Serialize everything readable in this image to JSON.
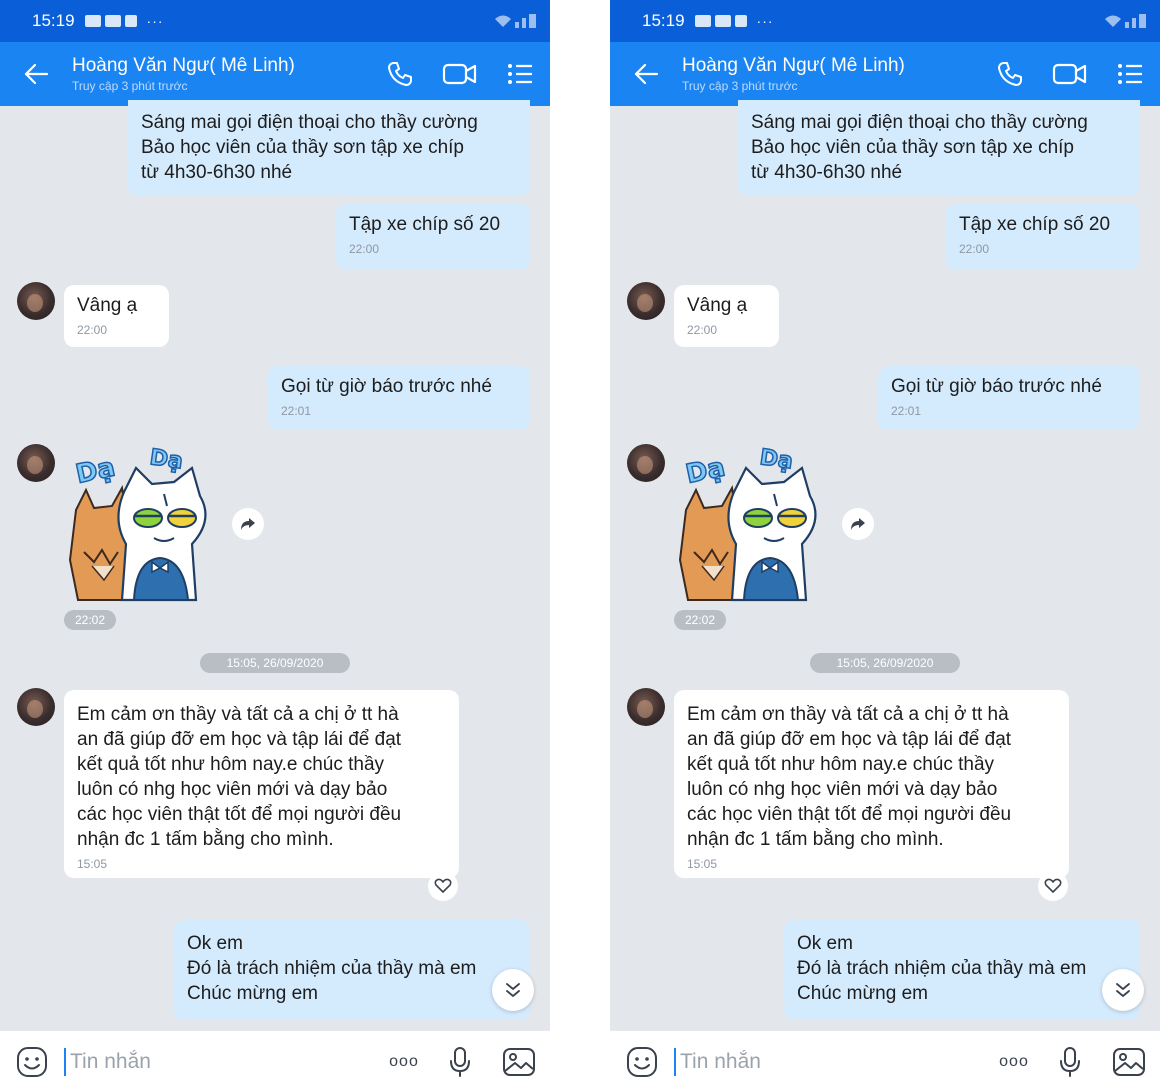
{
  "status": {
    "time": "15:19",
    "more": "···"
  },
  "header": {
    "name": "Hoàng Văn Ngư( Mê Linh)",
    "status": "Truy cập 3 phút trước",
    "back_icon": "arrow-left-icon",
    "call_icon": "phone-icon",
    "video_icon": "video-camera-icon",
    "menu_icon": "list-menu-icon"
  },
  "messages": {
    "m1": {
      "lines": [
        "Sáng mai gọi điện thoại cho thầy cường",
        "Bảo học viên của thầy sơn tập xe chíp",
        "từ 4h30-6h30 nhé"
      ]
    },
    "m2": {
      "text": "Tập xe chíp số 20",
      "time": "22:00"
    },
    "m3": {
      "text": "Vâng ạ",
      "time": "22:00"
    },
    "m4": {
      "text": "Gọi từ giờ báo trước nhé",
      "time": "22:01"
    },
    "sticker": {
      "label_left": "Dạ",
      "label_right": "Dạ",
      "time": "22:02"
    },
    "divider": "15:05, 26/09/2020",
    "m5": {
      "lines": [
        "Em cảm ơn thầy và tất cả a chị ở tt hà",
        "an đã giúp đỡ em học và tập lái để đạt",
        "kết quả tốt như hôm nay.e chúc thầy",
        "luôn có nhg học viên mới và dạy bảo",
        "các học viên thật tốt để mọi người đều",
        "nhận đc 1 tấm bằng cho mình."
      ],
      "time": "15:05"
    },
    "m6": {
      "lines": [
        "Ok em",
        "Đó là trách nhiệm của thầy mà em",
        "Chúc mừng em"
      ]
    }
  },
  "input": {
    "placeholder": "Tin nhắn",
    "more": "ooo"
  },
  "colors": {
    "status_bar": "#0a5fd8",
    "header": "#1a84f2",
    "outgoing": "#d4eafd",
    "incoming": "#ffffff",
    "chat_bg": "#e3e7ec"
  }
}
